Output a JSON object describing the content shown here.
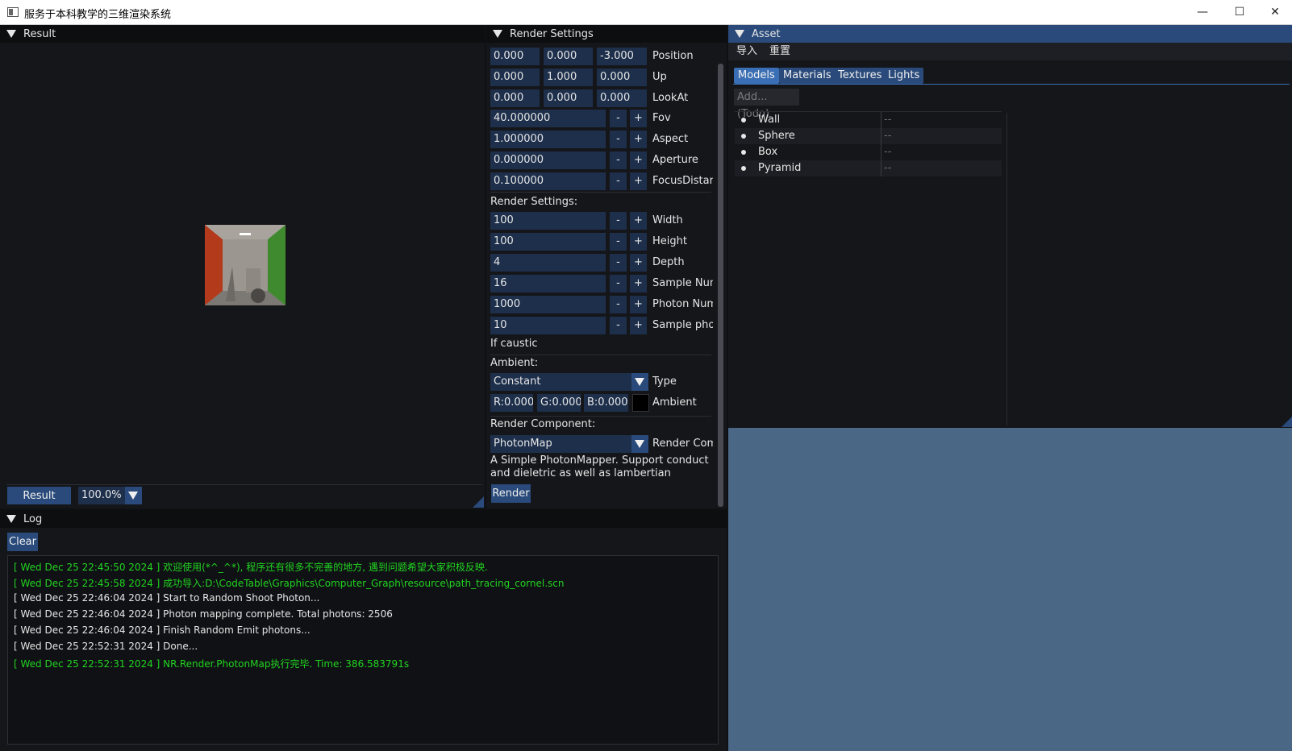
{
  "window": {
    "title": "服务于本科教学的三维渲染系统",
    "minimize": "—",
    "maximize": "☐",
    "close": "✕"
  },
  "result_panel": {
    "title": "Result",
    "view_button": "Result",
    "zoom": "100.0%"
  },
  "render_settings": {
    "title": "Render Settings",
    "camera": [
      {
        "label": "Position",
        "values": [
          "0.000",
          "0.000",
          "-3.000"
        ]
      },
      {
        "label": "Up",
        "values": [
          "0.000",
          "1.000",
          "0.000"
        ]
      },
      {
        "label": "LookAt",
        "values": [
          "0.000",
          "0.000",
          "0.000"
        ]
      }
    ],
    "camera_params": [
      {
        "label": "Fov",
        "value": "40.000000"
      },
      {
        "label": "Aspect",
        "value": "1.000000"
      },
      {
        "label": "Aperture",
        "value": "0.000000"
      },
      {
        "label": "FocusDistanc",
        "value": "0.100000"
      }
    ],
    "section_label": "Render Settings:",
    "render_params": [
      {
        "label": "Width",
        "value": "100"
      },
      {
        "label": "Height",
        "value": "100"
      },
      {
        "label": "Depth",
        "value": "4"
      },
      {
        "label": "Sample Num",
        "value": "16"
      },
      {
        "label": "Photon Num",
        "value": "1000"
      },
      {
        "label": "Sample phot",
        "value": "10"
      }
    ],
    "minus": "-",
    "plus": "+",
    "if_caustic": "If caustic",
    "ambient_label": "Ambient:",
    "ambient_type_value": "Constant",
    "ambient_type_label": "Type",
    "ambient_r": "R:0.000",
    "ambient_g": "G:0.000",
    "ambient_b": "B:0.000",
    "ambient_label2": "Ambient",
    "ambient_color": "#000000",
    "component_label": "Render Component:",
    "component_value": "PhotonMap",
    "component_combo_label": "Render Comp",
    "description_line1": "A Simple PhotonMapper. Support conduct",
    "description_line2": "and dieletric as well as lambertian",
    "render_button": "Render"
  },
  "asset_panel": {
    "title": "Asset",
    "menu": [
      "导入",
      "重置"
    ],
    "tabs": [
      "Models",
      "Materials",
      "Textures",
      "Lights"
    ],
    "add_button": "Add...(Todo)",
    "models": [
      {
        "name": "Wall",
        "value": "--"
      },
      {
        "name": "Sphere",
        "value": "--"
      },
      {
        "name": "Box",
        "value": "--"
      },
      {
        "name": "Pyramid",
        "value": "--"
      }
    ]
  },
  "log_panel": {
    "title": "Log",
    "clear_button": "Clear",
    "lines": [
      {
        "text": "[ Wed Dec 25 22:45:50 2024 ] 欢迎使用(*^_^*), 程序还有很多不完善的地方, 遇到问题希望大家积极反映.",
        "color": "green"
      },
      {
        "text": "[ Wed Dec 25 22:45:58 2024 ] 成功导入:D:\\CodeTable\\Graphics\\Computer_Graph\\resource\\path_tracing_cornel.scn",
        "color": "green"
      },
      {
        "text": "[ Wed Dec 25 22:46:04 2024 ] Start to Random Shoot Photon...",
        "color": "white"
      },
      {
        "text": "[ Wed Dec 25 22:46:04 2024 ] Photon mapping complete. Total photons: 2506",
        "color": "white"
      },
      {
        "text": "[ Wed Dec 25 22:46:04 2024 ] Finish Random Emit photons...",
        "color": "white"
      },
      {
        "text": "[ Wed Dec 25 22:52:31 2024 ] Done...",
        "color": "white"
      },
      {
        "text": "[ Wed Dec 25 22:52:31 2024 ] NR.Render.PhotonMap执行完毕. Time: 386.583791s",
        "color": "green"
      }
    ]
  },
  "colors": {
    "accent": "#294a7a",
    "log_green": "#21d421",
    "viewport_bg": "#4a6786"
  }
}
